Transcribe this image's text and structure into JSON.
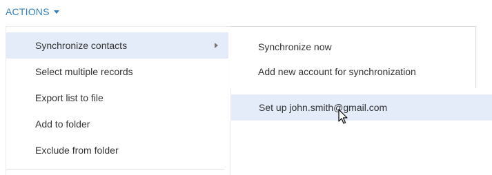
{
  "header": {
    "actions_label": "ACTIONS",
    "caret_icon": "caret-down-icon"
  },
  "actions_menu": {
    "items": [
      {
        "label": "Synchronize contacts",
        "active": true,
        "has_submenu": true
      },
      {
        "label": "Select multiple records",
        "active": false,
        "has_submenu": false
      },
      {
        "label": "Export list to file",
        "active": false,
        "has_submenu": false
      },
      {
        "label": "Add to folder",
        "active": false,
        "has_submenu": false
      },
      {
        "label": "Exclude from folder",
        "active": false,
        "has_submenu": false
      }
    ],
    "submenu_arrow_icon": "chevron-right-icon"
  },
  "sync_submenu": {
    "items": [
      {
        "label": "Synchronize now"
      },
      {
        "label": "Add new account for synchronization"
      }
    ]
  },
  "account_submenu": {
    "items": [
      {
        "label": "Set up john.smith@gmail.com",
        "active": true
      }
    ]
  },
  "pointer": {
    "icon": "mouse-pointer-icon"
  },
  "colors": {
    "link_blue": "#2f7fbf",
    "highlight": "#e4ecf9",
    "text": "#333333"
  }
}
